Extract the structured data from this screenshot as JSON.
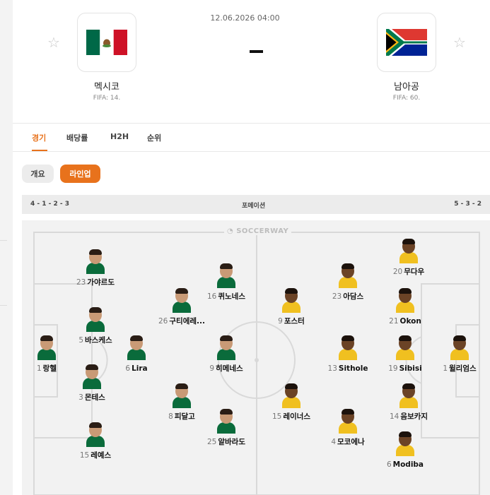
{
  "match": {
    "datetime": "12.06.2026 04:00",
    "home": {
      "name": "멕시코",
      "fifa": "FIFA: 14."
    },
    "away": {
      "name": "남아공",
      "fifa": "FIFA: 60."
    },
    "favorite_icon": "star-icon"
  },
  "tabs": [
    {
      "label": "경기",
      "active": true
    },
    {
      "label": "배당률",
      "active": false
    },
    {
      "label": "H2H",
      "active": false
    },
    {
      "label": "순위",
      "active": false
    }
  ],
  "subtabs": [
    {
      "label": "개요",
      "active": false
    },
    {
      "label": "라인업",
      "active": true
    }
  ],
  "formation": {
    "home": "4 - 1 - 2 - 3",
    "title": "포메이션",
    "away": "5 - 3 - 2"
  },
  "pitch": {
    "brand": "SOCCERWAY"
  },
  "colors": {
    "accent": "#e8721c",
    "mexico_green": "#006847",
    "mexico_red": "#ce1126"
  },
  "home_players": [
    {
      "num": "1",
      "name": "랑헬"
    },
    {
      "num": "23",
      "name": "가야르도"
    },
    {
      "num": "5",
      "name": "바스케스"
    },
    {
      "num": "3",
      "name": "몬테스"
    },
    {
      "num": "15",
      "name": "레예스"
    },
    {
      "num": "6",
      "name": "Lira"
    },
    {
      "num": "26",
      "name": "구티에레..."
    },
    {
      "num": "8",
      "name": "피달고"
    },
    {
      "num": "16",
      "name": "퀴노네스"
    },
    {
      "num": "9",
      "name": "히메네스"
    },
    {
      "num": "25",
      "name": "알바라도"
    }
  ],
  "away_players": [
    {
      "num": "9",
      "name": "포스터"
    },
    {
      "num": "15",
      "name": "레이너스"
    },
    {
      "num": "23",
      "name": "아담스"
    },
    {
      "num": "13",
      "name": "Sithole"
    },
    {
      "num": "4",
      "name": "모코에나"
    },
    {
      "num": "20",
      "name": "무다우"
    },
    {
      "num": "21",
      "name": "Okon"
    },
    {
      "num": "19",
      "name": "Sibisi"
    },
    {
      "num": "14",
      "name": "음보카지"
    },
    {
      "num": "6",
      "name": "Modiba"
    },
    {
      "num": "1",
      "name": "윌리엄스"
    }
  ]
}
